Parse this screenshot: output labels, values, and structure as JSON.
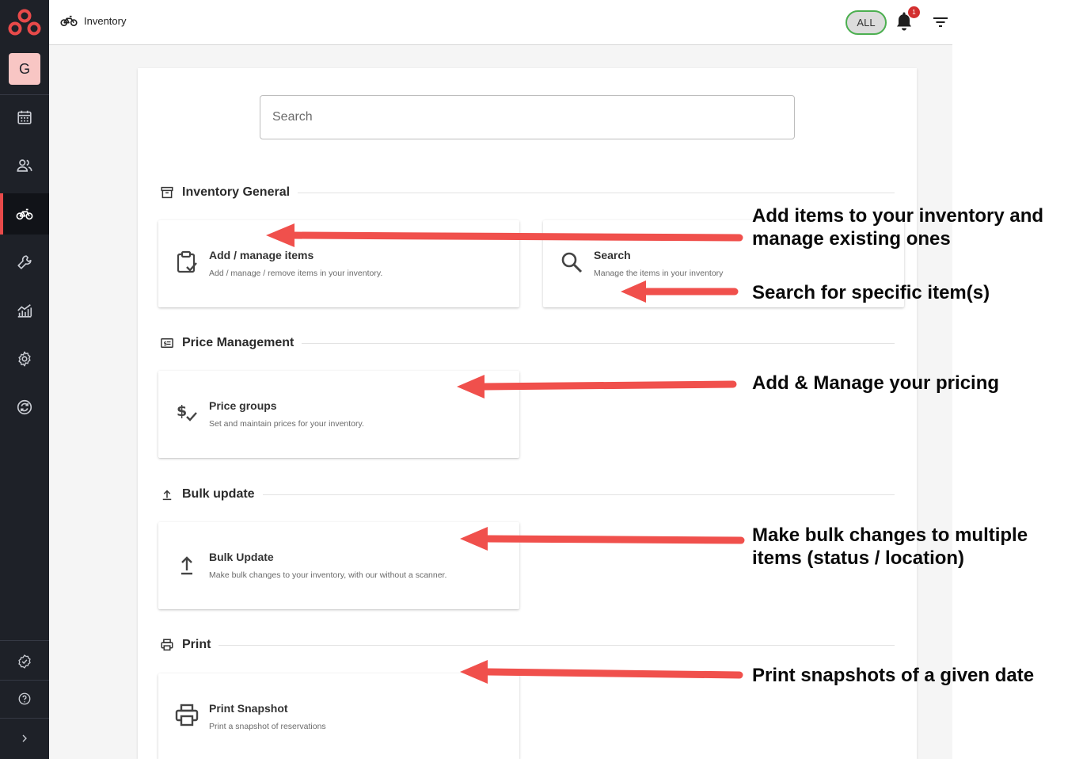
{
  "app": {
    "avatar_letter": "G",
    "page_title": "Inventory",
    "filter_chip": "ALL",
    "notification_count": "1"
  },
  "colors": {
    "sidebar_bg": "#1e2128",
    "accent": "#e84a4a",
    "arrow": "#f0504c",
    "chip_border": "#4caf50"
  },
  "sidebar": {
    "items": [
      {
        "icon": "calendar-icon"
      },
      {
        "icon": "users-icon"
      },
      {
        "icon": "bike-icon",
        "active": true
      },
      {
        "icon": "wrench-icon"
      },
      {
        "icon": "analytics-icon"
      },
      {
        "icon": "gear-icon"
      },
      {
        "icon": "sync-icon"
      },
      {
        "icon": "check-badge-icon"
      },
      {
        "icon": "help-icon"
      },
      {
        "icon": "chevron-right-icon"
      }
    ]
  },
  "search": {
    "placeholder": "Search"
  },
  "sections": [
    {
      "title": "Inventory General",
      "icon": "archive-icon",
      "cards": [
        {
          "title": "Add / manage items",
          "desc": "Add / manage / remove items in your inventory.",
          "icon": "clipboard-check-icon"
        },
        {
          "title": "Search",
          "desc": "Manage the items in your inventory",
          "icon": "search-icon"
        }
      ]
    },
    {
      "title": "Price Management",
      "icon": "price-tag-icon",
      "cards": [
        {
          "title": "Price groups",
          "desc": "Set and maintain prices for your inventory.",
          "icon": "dollar-check-icon"
        }
      ]
    },
    {
      "title": "Bulk update",
      "icon": "upload-icon",
      "cards": [
        {
          "title": "Bulk Update",
          "desc": "Make bulk changes to your inventory, with our without a scanner.",
          "icon": "upload-icon"
        }
      ]
    },
    {
      "title": "Print",
      "icon": "printer-icon",
      "cards": [
        {
          "title": "Print Snapshot",
          "desc": "Print a snapshot of reservations",
          "icon": "printer-icon"
        }
      ]
    }
  ],
  "annotations": [
    "Add items to your inventory and\nmanage existing ones",
    "Search for specific item(s)",
    "Add & Manage your pricing",
    "Make bulk changes to multiple\nitems (status / location)",
    "Print snapshots of a given date"
  ]
}
